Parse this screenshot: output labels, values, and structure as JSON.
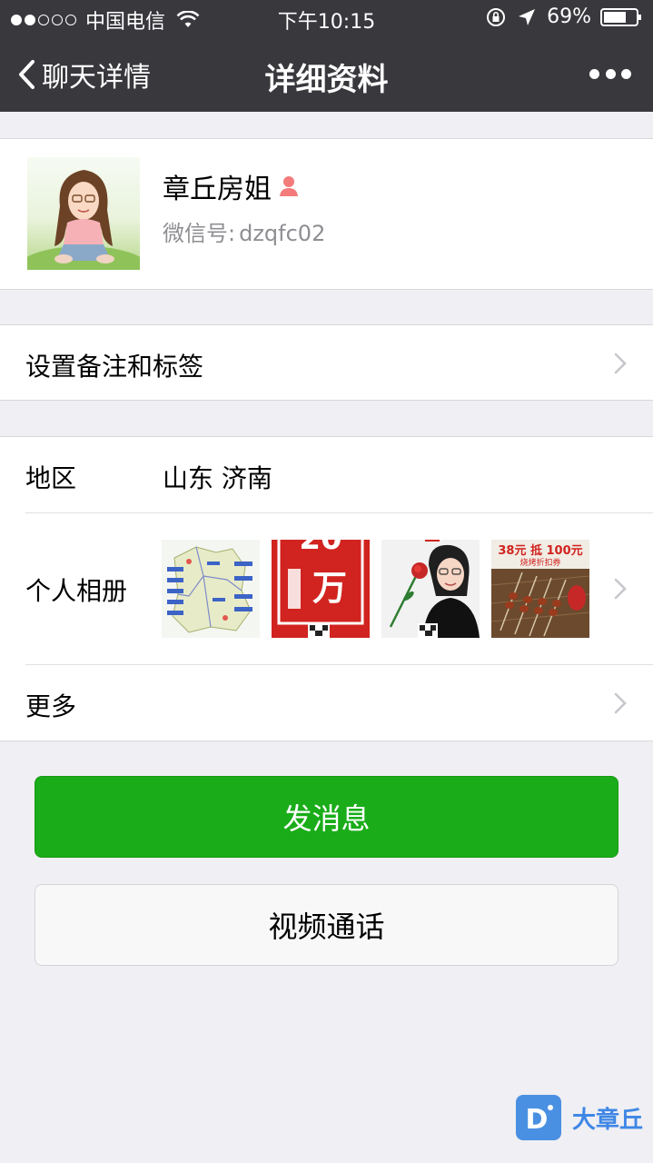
{
  "status_bar": {
    "carrier": "中国电信",
    "time": "下午10:15",
    "battery": "69%"
  },
  "nav": {
    "back_label": "聊天详情",
    "title": "详细资料",
    "more_icon": "more-dots-icon"
  },
  "profile": {
    "name": "章丘房姐",
    "gender_icon": "female-icon",
    "wechat_id_label": "微信号:",
    "wechat_id": "dzqfc02"
  },
  "remark": {
    "label": "设置备注和标签"
  },
  "info": {
    "region_label": "地区",
    "region_value": "山东 济南",
    "album_label": "个人相册",
    "album_thumb_2_text": "20万",
    "album_thumb_4_text": "38元 抵 100元",
    "album_thumb_4_sub": "烧烤折扣券",
    "more_label": "更多"
  },
  "actions": {
    "send_message": "发消息",
    "video_call": "视频通话"
  },
  "watermark": {
    "text": "大章丘"
  },
  "colors": {
    "topbar": "#38383d",
    "background": "#efeff4",
    "primary_green": "#1aad19",
    "secondary_text": "#8e8e93"
  }
}
